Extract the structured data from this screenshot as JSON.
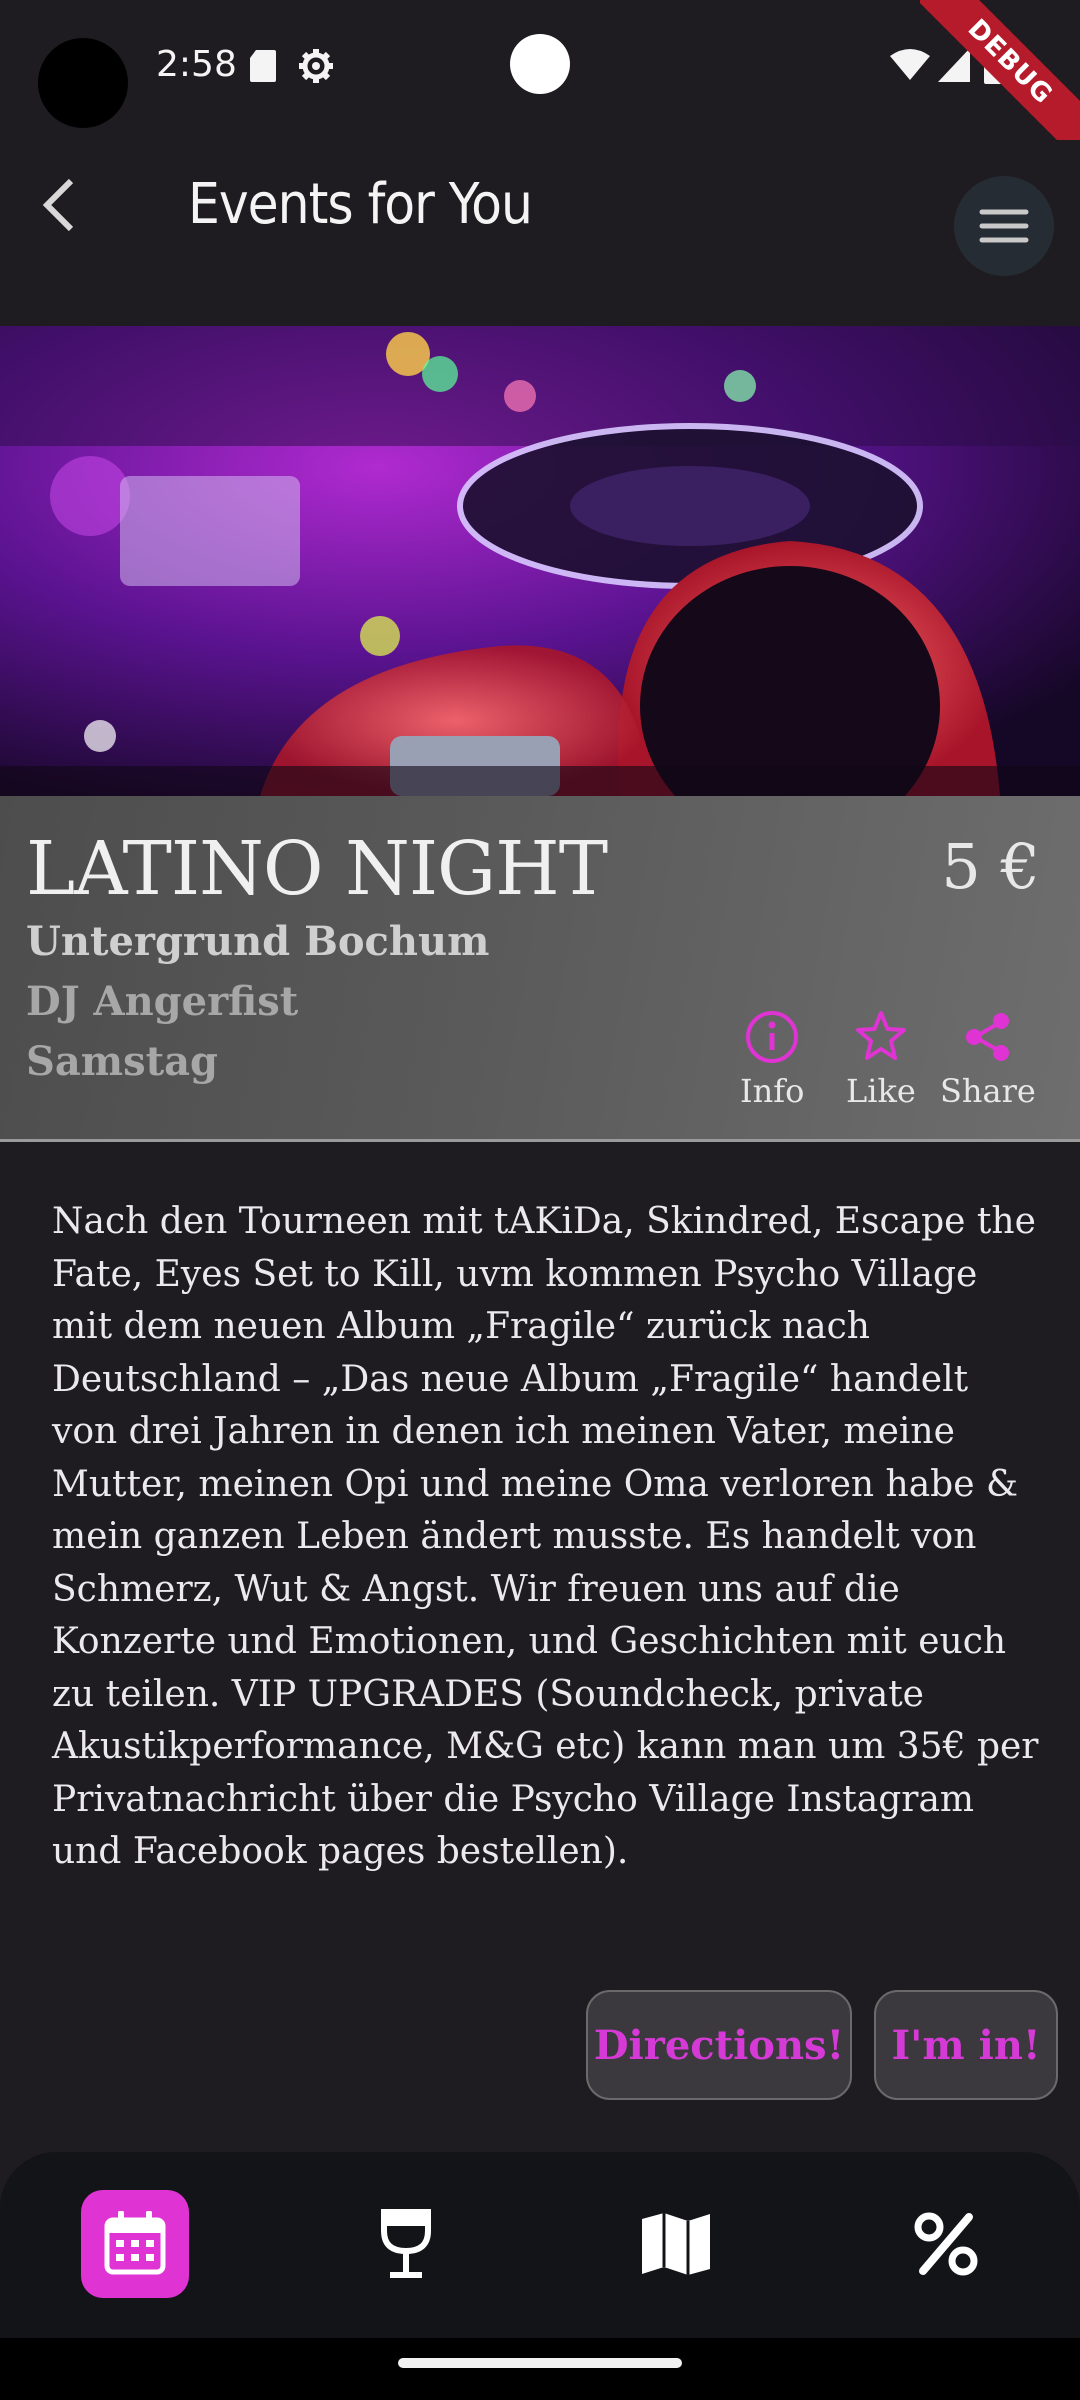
{
  "status_bar": {
    "time": "2:58",
    "debug_label": "DEBUG"
  },
  "app_bar": {
    "title": "Events for You",
    "back_icon": "chevron-left-icon",
    "menu_icon": "hamburger-menu-icon"
  },
  "event": {
    "title": "LATINO NIGHT",
    "price": "5 €",
    "venue": "Untergrund Bochum",
    "artist": "DJ Angerfist",
    "day": "Samstag",
    "description": "Nach den Tourneen mit tAKiDa, Skindred, Escape the Fate, Eyes Set to Kill, uvm kommen Psycho Village mit dem neuen Album „Fragile“ zurück nach Deutschland – „Das neue Album „Fragile“ handelt von drei Jahren in denen ich meinen Vater, meine Mutter, meinen Opi und meine Oma verloren habe & mein ganzen Leben ändert musste. Es handelt von Schmerz, Wut & Angst. Wir freuen uns auf die Konzerte und Emotionen, und Geschichten mit euch zu teilen. VIP UPGRADES (Soundcheck, private Akustikperformance, M&G etc) kann man um 35€ per Privatnachricht über die Psycho Village Instagram und Facebook pages bestellen)."
  },
  "actions": {
    "info_label": "Info",
    "like_label": "Like",
    "share_label": "Share"
  },
  "buttons": {
    "directions_label": "Directions!",
    "im_in_label": "I'm in!"
  },
  "bottom_nav": {
    "active": "events",
    "items": [
      {
        "id": "events",
        "icon": "calendar-icon"
      },
      {
        "id": "drinks",
        "icon": "wine-glass-icon"
      },
      {
        "id": "map",
        "icon": "map-icon"
      },
      {
        "id": "deals",
        "icon": "percent-icon"
      }
    ]
  },
  "colors": {
    "accent": "#e033d3",
    "background": "#1e1c20",
    "nav_background": "#121418"
  }
}
